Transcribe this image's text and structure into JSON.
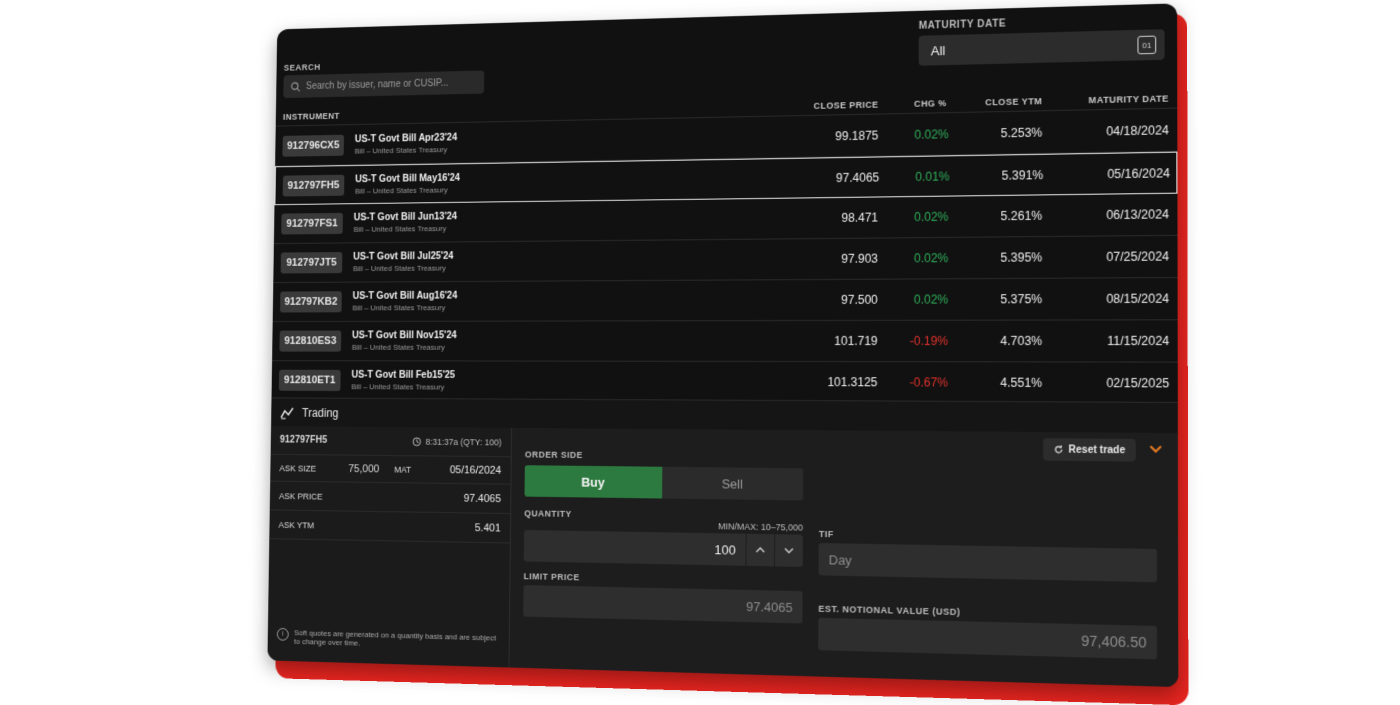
{
  "search": {
    "label": "SEARCH",
    "placeholder": "Search by issuer, name or CUSIP..."
  },
  "maturity_filter": {
    "label": "MATURITY DATE",
    "value": "All",
    "calendar_icon_text": "01"
  },
  "table": {
    "headers": {
      "instrument": "INSTRUMENT",
      "close_price": "CLOSE PRICE",
      "chg": "CHG %",
      "close_ytm": "CLOSE YTM",
      "maturity": "MATURITY DATE"
    },
    "rows": [
      {
        "cusip": "912796CX5",
        "title": "US-T Govt Bill Apr23'24",
        "subtitle": "Bill – United States Treasury",
        "price": "99.1875",
        "chg": "0.02%",
        "ytm": "5.253%",
        "maturity": "04/18/2024"
      },
      {
        "cusip": "912797FH5",
        "title": "US-T Govt Bill May16'24",
        "subtitle": "Bill – United States Treasury",
        "price": "97.4065",
        "chg": "0.01%",
        "ytm": "5.391%",
        "maturity": "05/16/2024"
      },
      {
        "cusip": "912797FS1",
        "title": "US-T Govt Bill Jun13'24",
        "subtitle": "Bill – United States Treasury",
        "price": "98.471",
        "chg": "0.02%",
        "ytm": "5.261%",
        "maturity": "06/13/2024"
      },
      {
        "cusip": "912797JT5",
        "title": "US-T Govt Bill Jul25'24",
        "subtitle": "Bill – United States Treasury",
        "price": "97.903",
        "chg": "0.02%",
        "ytm": "5.395%",
        "maturity": "07/25/2024"
      },
      {
        "cusip": "912797KB2",
        "title": "US-T Govt Bill Aug16'24",
        "subtitle": "Bill – United States Treasury",
        "price": "97.500",
        "chg": "0.02%",
        "ytm": "5.375%",
        "maturity": "08/15/2024"
      },
      {
        "cusip": "912810ES3",
        "title": "US-T Govt Bill Nov15'24",
        "subtitle": "Bill – United States Treasury",
        "price": "101.719",
        "chg": "-0.19%",
        "ytm": "4.703%",
        "maturity": "11/15/2024"
      },
      {
        "cusip": "912810ET1",
        "title": "US-T Govt Bill Feb15'25",
        "subtitle": "Bill – United States Treasury",
        "price": "101.3125",
        "chg": "-0.67%",
        "ytm": "4.551%",
        "maturity": "02/15/2025"
      }
    ]
  },
  "trading": {
    "title": "Trading",
    "cusip": "912797FH5",
    "timestamp": "8:31:37a (QTY: 100)",
    "ask_size_label": "ASK SIZE",
    "ask_size": "75,000",
    "mat_label": "MAT",
    "mat": "05/16/2024",
    "ask_price_label": "ASK PRICE",
    "ask_price": "97.4065",
    "ask_ytm_label": "ASK YTM",
    "ask_ytm": "5.401",
    "note": "Soft quotes are generated on a quantity basis and are subject to change over time."
  },
  "order": {
    "reset_label": "Reset trade",
    "side_label": "ORDER SIDE",
    "buy": "Buy",
    "sell": "Sell",
    "quantity_label": "QUANTITY",
    "minmax": "MIN/MAX: 10–75,000",
    "quantity": "100",
    "tif_label": "TIF",
    "tif": "Day",
    "limit_label": "LIMIT PRICE",
    "limit": "97.4065",
    "notional_label": "EST. NOTIONAL VALUE (USD)",
    "notional": "97,406.50"
  },
  "colors": {
    "positive": "#2fae5a",
    "negative": "#e0322c",
    "buy": "#2c7a3f",
    "accent": "#e37b24",
    "frame": "#e8241f"
  }
}
